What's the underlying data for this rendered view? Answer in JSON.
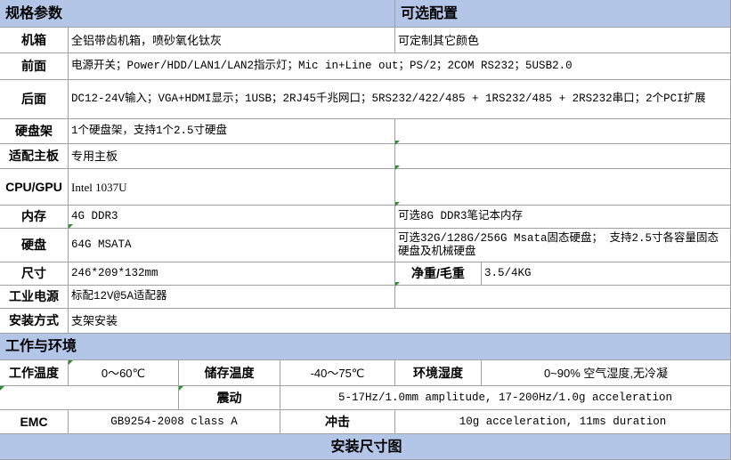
{
  "spec_header": "规格参数",
  "options_header": "可选配置",
  "rows": [
    {
      "label": "机箱",
      "spec": "全铝带齿机箱，喷砂氧化钛灰",
      "option": "可定制其它颜色"
    },
    {
      "label": "前面",
      "spec": "电源开关；Power/HDD/LAN1/LAN2指示灯；Mic in+Line out；PS/2；2COM RS232；5USB2.0",
      "option": ""
    },
    {
      "label": "后面",
      "spec": "DC12-24V输入；VGA+HDMI显示；1USB；2RJ45千兆网口；5RS232/422/485 + 1RS232/485 + 2RS232串口；2个PCI扩展",
      "option": ""
    },
    {
      "label": "硬盘架",
      "spec": "1个硬盘架，支持1个2.5寸硬盘",
      "option": ""
    },
    {
      "label": "适配主板",
      "spec": "专用主板",
      "option": ""
    },
    {
      "label": "CPU/GPU",
      "spec": "Intel 1037U",
      "option": ""
    },
    {
      "label": "内存",
      "spec": "4G DDR3",
      "option": "可选8G DDR3笔记本内存"
    },
    {
      "label": "硬盘",
      "spec": "64G MSATA",
      "option": "可选32G/128G/256G Msata固态硬盘； 支持2.5寸各容量固态硬盘及机械硬盘"
    }
  ],
  "size": {
    "label": "尺寸",
    "value": "246*209*132mm",
    "weight_label": "净重/毛重",
    "weight_value": "3.5/4KG"
  },
  "power": {
    "label": "工业电源",
    "value": "标配12V@5A适配器"
  },
  "mount": {
    "label": "安装方式",
    "value": "支架安装"
  },
  "env_header": "工作与环境",
  "env": {
    "work_temp_label": "工作温度",
    "work_temp": "0～60℃",
    "store_temp_label": "储存温度",
    "store_temp": "-40～75℃",
    "humidity_label": "环境湿度",
    "humidity": "0~90% 空气湿度,无冷凝",
    "vibration_label": "震动",
    "vibration": "5-17Hz/1.0mm amplitude, 17-200Hz/1.0g acceleration",
    "emc_label": "EMC",
    "emc": "GB9254-2008 class A",
    "shock_label": "冲击",
    "shock": "10g acceleration, 11ms duration"
  },
  "install_header": "安装尺寸图",
  "colors": {
    "header_bg": "#b4c6e7",
    "grid": "#a0a0a0",
    "marker": "#2f8f2f"
  }
}
